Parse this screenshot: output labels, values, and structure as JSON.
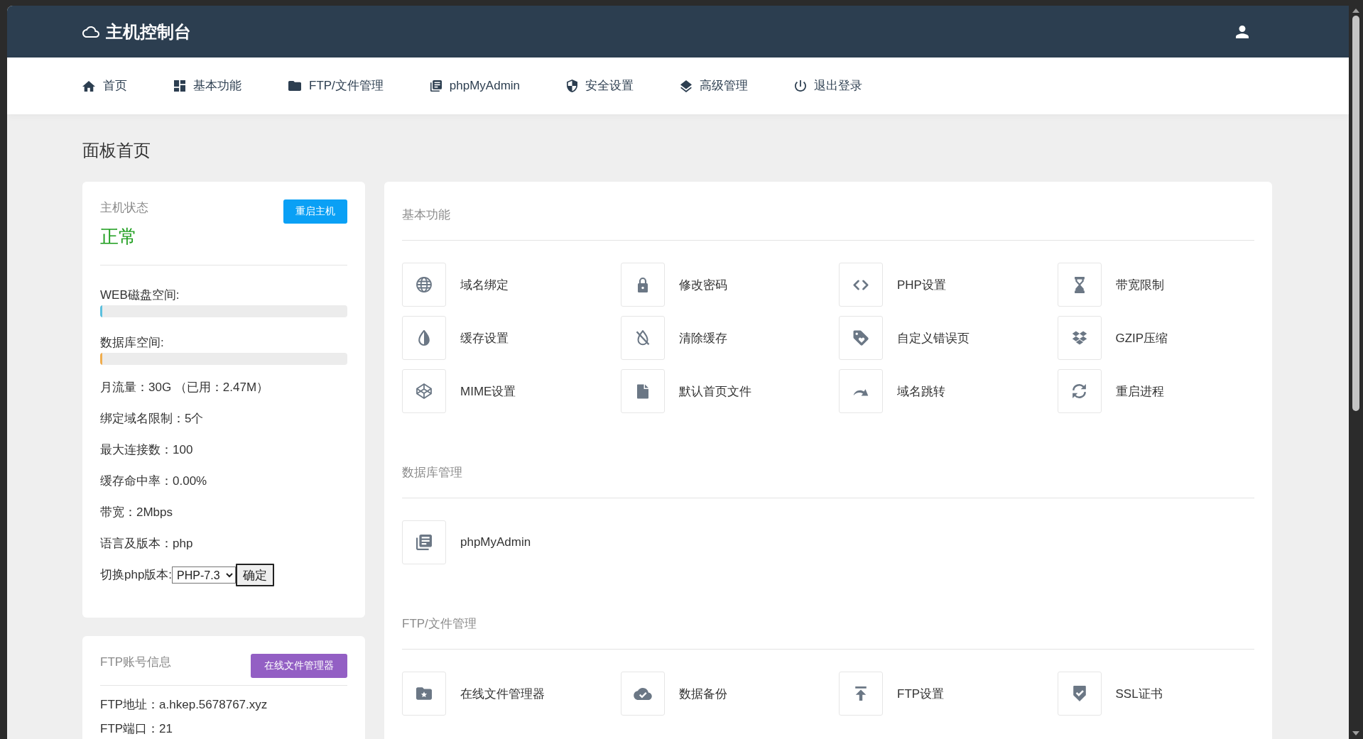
{
  "header": {
    "title": "主机控制台"
  },
  "nav": [
    "首页",
    "基本功能",
    "FTP/文件管理",
    "phpMyAdmin",
    "安全设置",
    "高级管理",
    "退出登录"
  ],
  "page_title": "面板首页",
  "host_status": {
    "title": "主机状态",
    "button": "重启主机",
    "status": "正常",
    "usage": [
      {
        "label": "WEB磁盘空间:",
        "level": 0.01,
        "color": "#5bc0de"
      },
      {
        "label": "数据库空间:",
        "level": 0.01,
        "color": "#f0ad4e"
      }
    ],
    "stats": [
      "月流量：30G （已用：2.47M）",
      "绑定域名限制：5个",
      "最大连接数：100",
      "缓存命中率：0.00%",
      "带宽：2Mbps",
      "语言及版本：php"
    ],
    "php_switch": {
      "label": "切换php版本:",
      "value": "PHP-7.3",
      "button": "确定"
    }
  },
  "ftp_account": {
    "title": "FTP账号信息",
    "button": "在线文件管理器",
    "stats": [
      "FTP地址：a.hkep.5678767.xyz",
      "FTP端口：21"
    ]
  },
  "sections": [
    {
      "title": "基本功能",
      "items": [
        "域名绑定",
        "修改密码",
        "PHP设置",
        "带宽限制",
        "缓存设置",
        "清除缓存",
        "自定义错误页",
        "GZIP压缩",
        "MIME设置",
        "默认首页文件",
        "域名跳转",
        "重启进程"
      ]
    },
    {
      "title": "数据库管理",
      "items": [
        "phpMyAdmin"
      ]
    },
    {
      "title": "FTP/文件管理",
      "items": [
        "在线文件管理器",
        "数据备份",
        "FTP设置",
        "SSL证书"
      ]
    }
  ]
}
